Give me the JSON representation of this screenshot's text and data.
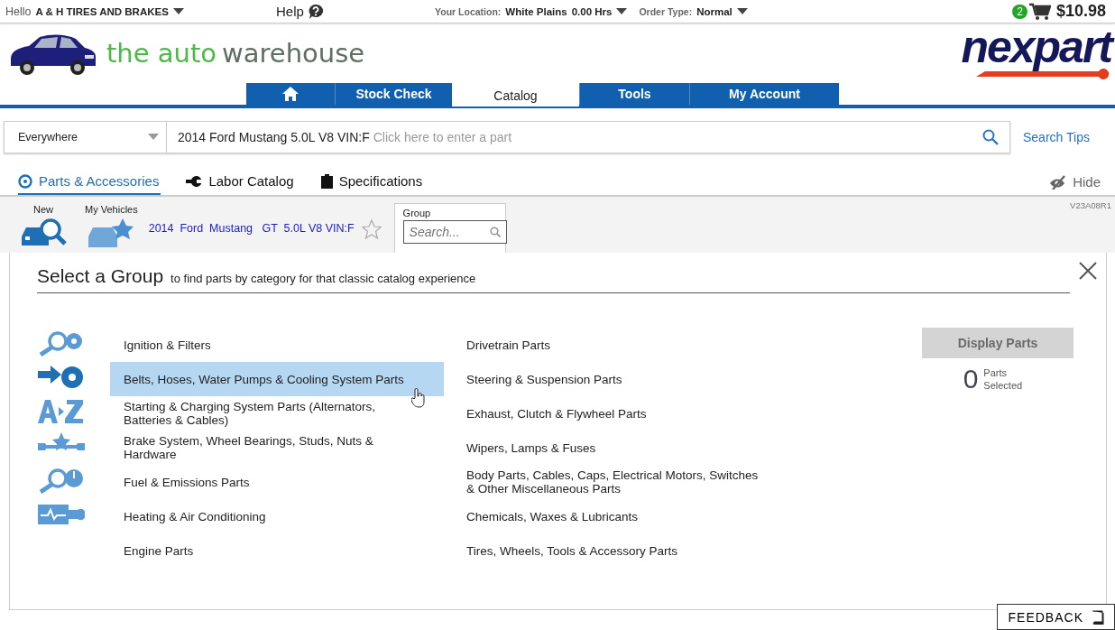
{
  "top_bar": {
    "greeting": "Hello",
    "account": "A & H TIRES AND BRAKES",
    "help": "Help",
    "location_label": "Your Location:",
    "location": "White Plains",
    "hours": "0.00 Hrs",
    "order_type_label": "Order Type:",
    "order_type": "Normal",
    "cart_count": "2",
    "cart_total": "$10.98"
  },
  "brand": {
    "lead": "the auto",
    "rest": "warehouse",
    "partner_logo": "nexpart"
  },
  "nav_tabs": [
    {
      "kind": "home",
      "selected": false
    },
    {
      "kind": "text",
      "label": "Stock Check",
      "selected": false
    },
    {
      "kind": "text",
      "label": "Catalog",
      "selected": true
    },
    {
      "kind": "text",
      "label": "Tools",
      "selected": false
    },
    {
      "kind": "text",
      "label": "My Account",
      "selected": false
    }
  ],
  "search": {
    "scope": "Everywhere",
    "vehicle": "2014 Ford Mustang 5.0L V8 VIN:F",
    "placeholder": "Click here to enter a part",
    "tips": "Search Tips"
  },
  "sub_tabs": [
    {
      "kind": "parts",
      "label": "Parts & Accessories",
      "selected": true
    },
    {
      "kind": "labor",
      "label": "Labor Catalog",
      "selected": false
    },
    {
      "kind": "specs",
      "label": "Specifications",
      "selected": false
    }
  ],
  "hide": "Hide",
  "version": "V23A08R1",
  "vehicle_bar": {
    "new": "New",
    "my_vehicles": "My Vehicles",
    "vehicle": "2014  Ford  Mustang   GT  5.0L V8 VIN:F",
    "group_label": "Group",
    "group_placeholder": "Search..."
  },
  "panel": {
    "title": "Select a Group",
    "subtitle": "to find parts by category for that classic catalog experience",
    "columns": [
      [
        {
          "label": "Ignition & Filters",
          "selected": false
        },
        {
          "label": "Belts, Hoses, Water Pumps & Cooling System Parts",
          "selected": true
        },
        {
          "label": "Starting & Charging System Parts (Alternators, Batteries & Cables)",
          "selected": false
        },
        {
          "label": "Brake System, Wheel Bearings, Studs, Nuts & Hardware",
          "selected": false
        },
        {
          "label": "Fuel & Emissions Parts",
          "selected": false
        },
        {
          "label": "Heating & Air Conditioning",
          "selected": false
        },
        {
          "label": "Engine Parts",
          "selected": false
        }
      ],
      [
        {
          "label": "Drivetrain Parts",
          "selected": false
        },
        {
          "label": "Steering & Suspension Parts",
          "selected": false
        },
        {
          "label": "Exhaust, Clutch & Flywheel Parts",
          "selected": false
        },
        {
          "label": "Wipers, Lamps & Fuses",
          "selected": false
        },
        {
          "label": "Body Parts, Cables, Caps, Electrical Motors, Switches & Other Miscellaneous Parts",
          "selected": false
        },
        {
          "label": "Chemicals, Waxes & Lubricants",
          "selected": false
        },
        {
          "label": "Tires, Wheels, Tools & Accessory Parts",
          "selected": false
        }
      ]
    ],
    "display_button": {
      "label": "Display Parts",
      "disabled": true
    },
    "count": "0",
    "count_label": "Parts Selected"
  },
  "feedback": "FEEDBACK"
}
